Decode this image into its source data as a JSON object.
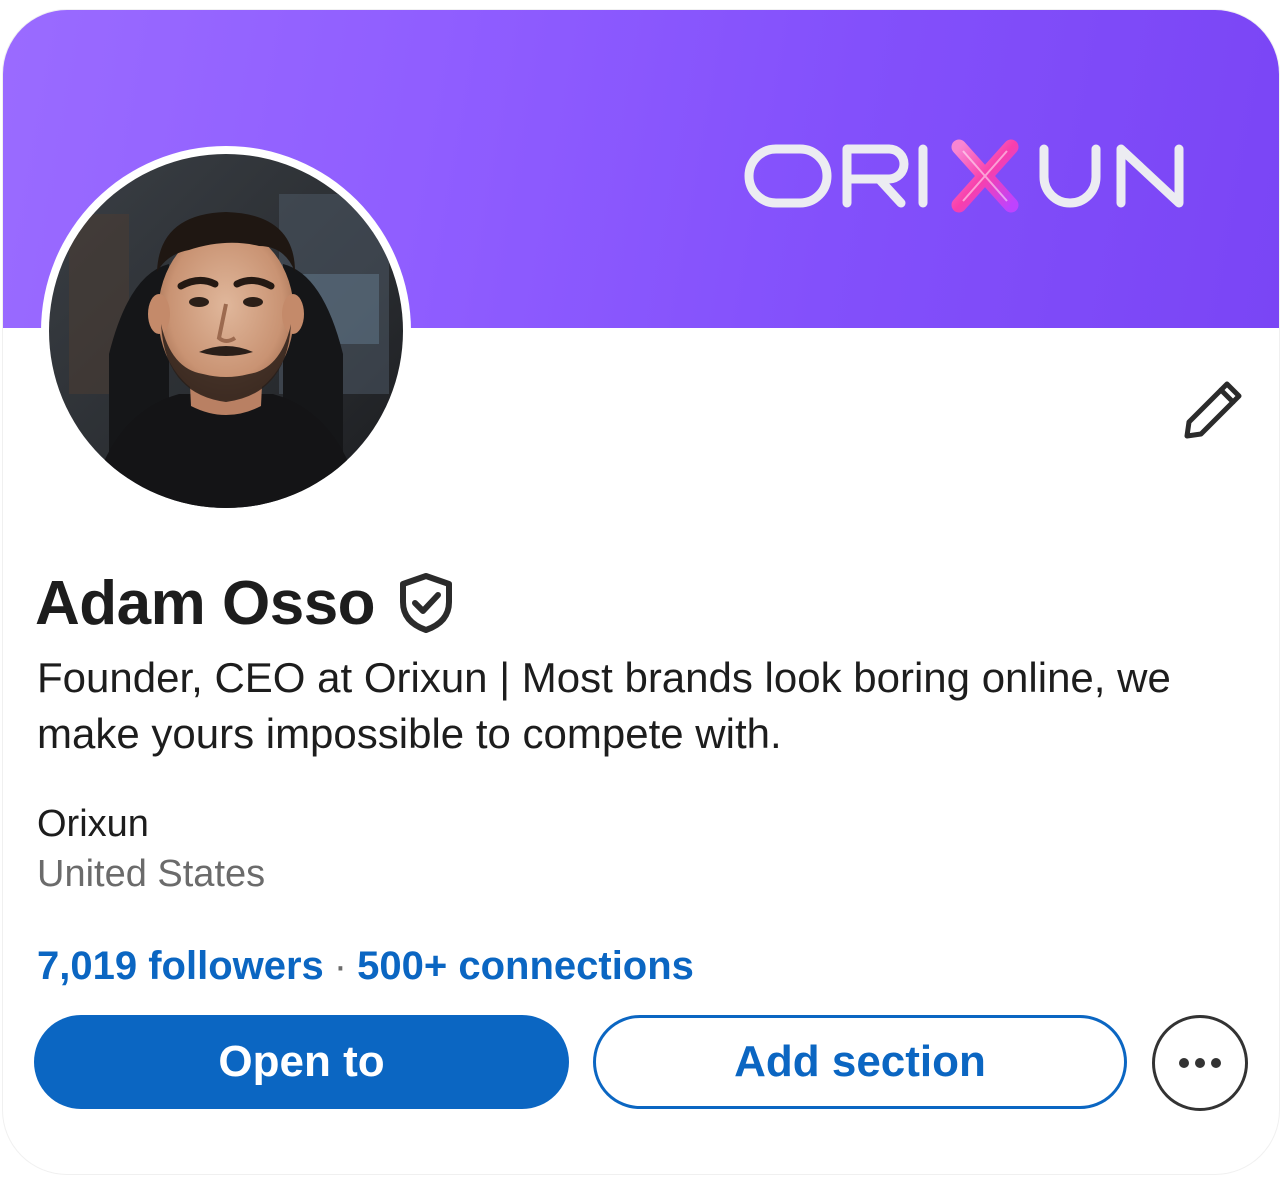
{
  "banner": {
    "logo_text": "ORIXUN",
    "gradient_colors": [
      "#9a6bff",
      "#7a45f5"
    ],
    "logo_color": "#e8e8ef",
    "logo_accent_color": "#ff4fb8"
  },
  "profile": {
    "avatar_icon": "profile-photo",
    "edit_icon": "pencil-icon",
    "name": "Adam Osso",
    "verified_icon": "verified-shield-icon",
    "headline": "Founder, CEO at Orixun | Most brands look boring online, we make yours impossible to compete with.",
    "company": "Orixun",
    "location": "United States",
    "followers": "7,019 followers",
    "separator": "·",
    "connections": "500+ connections"
  },
  "actions": {
    "open_to_label": "Open to",
    "add_section_label": "Add section",
    "more_icon": "more-ellipsis-icon"
  },
  "colors": {
    "accent": "#0b66c2",
    "text_primary": "#1d1d1d",
    "text_secondary": "#6b6b6b"
  }
}
